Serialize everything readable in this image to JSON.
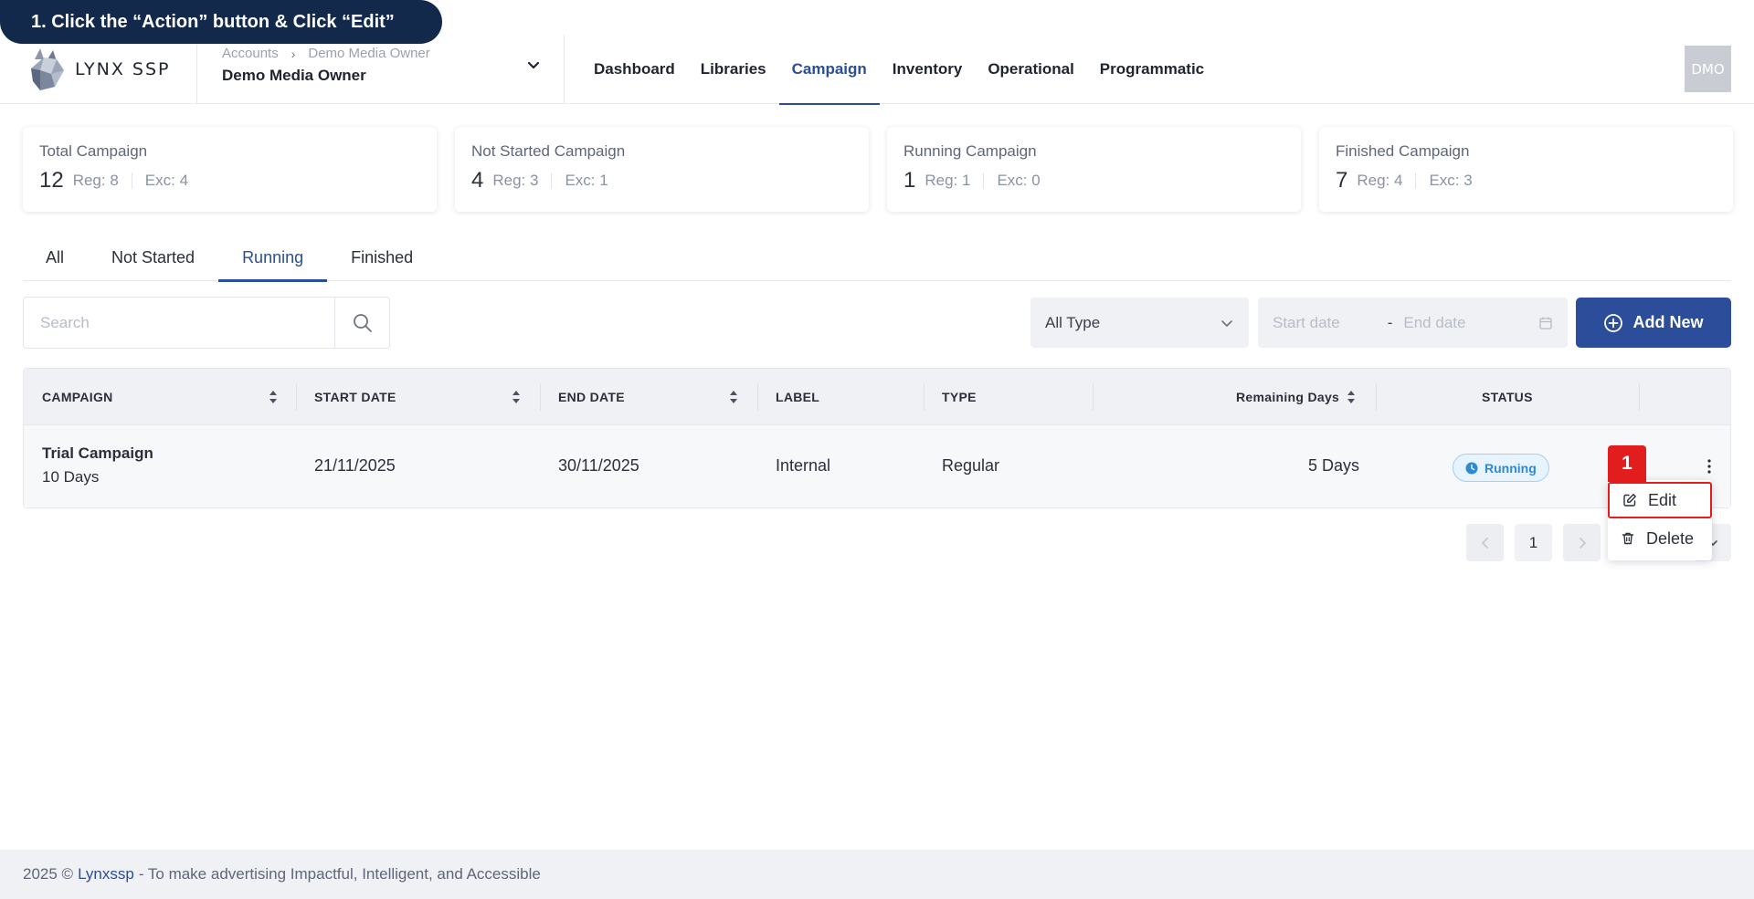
{
  "guide": {
    "step_text": "1. Click the “Action” button & Click “Edit”"
  },
  "header": {
    "logo_text": "LYNX SSP",
    "breadcrumb": [
      "Accounts",
      "Demo Media Owner"
    ],
    "breadcrumb_separator": "›",
    "account_name": "Demo Media Owner",
    "nav": [
      "Dashboard",
      "Libraries",
      "Campaign",
      "Inventory",
      "Operational",
      "Programmatic"
    ],
    "nav_active": "Campaign",
    "avatar_initials": "DMO"
  },
  "stats": [
    {
      "title": "Total Campaign",
      "total": "12",
      "reg": "Reg: 8",
      "exc": "Exc: 4"
    },
    {
      "title": "Not Started Campaign",
      "total": "4",
      "reg": "Reg: 3",
      "exc": "Exc: 1"
    },
    {
      "title": "Running Campaign",
      "total": "1",
      "reg": "Reg: 1",
      "exc": "Exc: 0"
    },
    {
      "title": "Finished Campaign",
      "total": "7",
      "reg": "Reg: 4",
      "exc": "Exc: 3"
    }
  ],
  "tabs": [
    "All",
    "Not Started",
    "Running",
    "Finished"
  ],
  "tab_active": "Running",
  "toolbar": {
    "search_placeholder": "Search",
    "type_select_value": "All Type",
    "start_date_placeholder": "Start date",
    "date_separator": "-",
    "end_date_placeholder": "End date",
    "add_new_label": "Add New"
  },
  "table": {
    "columns": [
      "CAMPAIGN",
      "START DATE",
      "END DATE",
      "LABEL",
      "TYPE",
      "Remaining Days",
      "STATUS"
    ],
    "rows": [
      {
        "campaign": "Trial Campaign",
        "duration": "10 Days",
        "start_date": "21/11/2025",
        "end_date": "30/11/2025",
        "label": "Internal",
        "type": "Regular",
        "remaining_days": "5 Days",
        "status": "Running"
      }
    ]
  },
  "pagination": {
    "current_page": "1",
    "prev_icon": "chevron-left-icon",
    "next_icon": "chevron-right-icon"
  },
  "action_menu": {
    "marker": "1",
    "edit_label": "Edit",
    "delete_label": "Delete"
  },
  "footer": {
    "year": "2025 ©",
    "brand_link": "Lynxssp",
    "tagline": "- To make advertising Impactful, Intelligent, and Accessible"
  },
  "colors": {
    "primary": "#2b4d9a",
    "highlight": "#e11d1d",
    "status_running": "#2a8ad8",
    "banner": "#13294b"
  }
}
